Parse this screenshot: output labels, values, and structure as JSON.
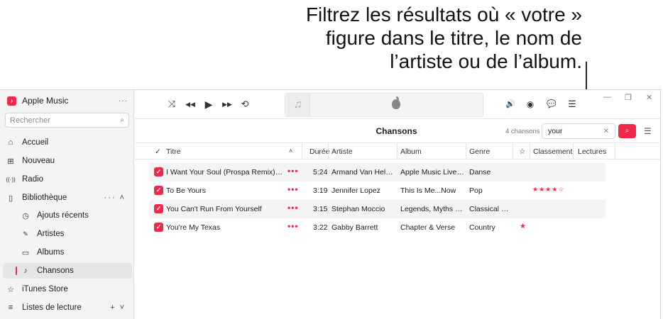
{
  "callout": {
    "line1": "Filtrez les résultats où « votre »",
    "line2": "figure dans le titre, le nom de",
    "line3": "l’artiste ou de l’album."
  },
  "sidebar": {
    "app_title": "Apple Music",
    "app_more": "···",
    "search_placeholder": "Rechercher",
    "items": [
      {
        "label": "Accueil",
        "icon": "home-icon",
        "glyph": "⌂"
      },
      {
        "label": "Nouveau",
        "icon": "grid-icon",
        "glyph": "⊞"
      },
      {
        "label": "Radio",
        "icon": "radio-icon",
        "glyph": "((·))"
      },
      {
        "label": "Bibliothèque",
        "icon": "library-icon",
        "glyph": "▯",
        "tail": "···  ˄"
      },
      {
        "label": "Ajouts récents",
        "icon": "clock-icon",
        "glyph": "◷"
      },
      {
        "label": "Artistes",
        "icon": "microphone-icon",
        "glyph": "🎤"
      },
      {
        "label": "Albums",
        "icon": "album-icon",
        "glyph": "▭"
      },
      {
        "label": "Chansons",
        "icon": "music-note-icon",
        "glyph": "♪"
      },
      {
        "label": "iTunes Store",
        "icon": "star-icon",
        "glyph": "☆"
      },
      {
        "label": "Listes de lecture",
        "icon": "playlist-icon",
        "glyph": "≡",
        "tail": "+   ˅"
      }
    ]
  },
  "toolbar": {
    "shuffle": "⤨",
    "previous": "◀◀",
    "play": "▶",
    "next": "▶▶",
    "repeat": "⟲",
    "volume": "🔊",
    "airplay": "◉",
    "lyrics": "💬",
    "queue": "☰",
    "minimize": "—",
    "restore": "❐",
    "close": "✕"
  },
  "header": {
    "title": "Chansons",
    "count": "4 chansons",
    "filter_value": "your",
    "clear": "✕"
  },
  "table": {
    "columns": {
      "check": "✓",
      "title": "Titre",
      "sort": "˄",
      "duration": "Durée",
      "artist": "Artiste",
      "album": "Album",
      "genre": "Genre",
      "favorite": "☆",
      "rating": "Classement",
      "plays": "Lectures"
    },
    "rows": [
      {
        "title": "I Want Your Soul (Prospa Remix) [Mixe...",
        "duration": "5:24",
        "artist": "Armand Van Helden",
        "album": "Apple Music Live: N...",
        "genre": "Danse",
        "rating": "",
        "favorite": ""
      },
      {
        "title": "To Be Yours",
        "duration": "3:19",
        "artist": "Jennifer Lopez",
        "album": "This Is Me...Now",
        "genre": "Pop",
        "rating": "★★★★☆",
        "favorite": ""
      },
      {
        "title": "You Can't Run From Yourself",
        "duration": "3:15",
        "artist": "Stephan Moccio",
        "album": "Legends, Myths and...",
        "genre": "Classical Cr...",
        "rating": "",
        "favorite": ""
      },
      {
        "title": "You're My Texas",
        "duration": "3:22",
        "artist": "Gabby Barrett",
        "album": "Chapter & Verse",
        "genre": "Country",
        "rating": "",
        "favorite": "★"
      }
    ],
    "check_glyph": "✓",
    "more_glyph": "•••"
  },
  "colors": {
    "accent": "#f0284a",
    "sidebar_bg": "#f4f4f4",
    "row_alt": "#f4f4f4"
  }
}
